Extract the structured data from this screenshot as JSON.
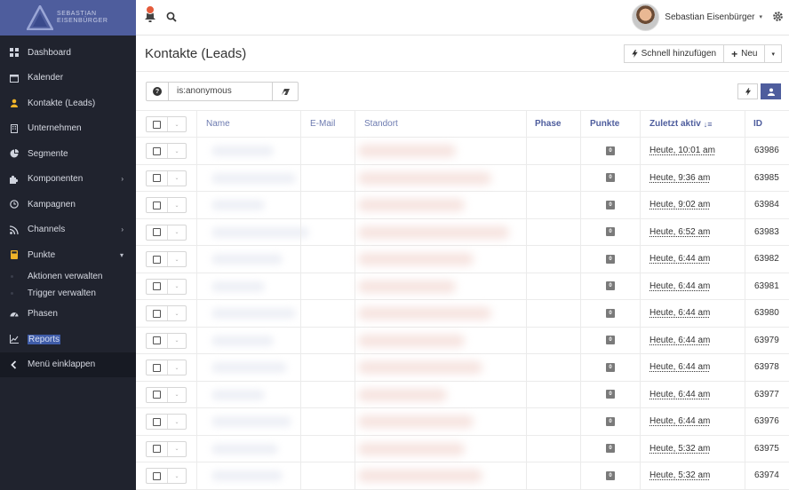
{
  "brand": {
    "line1": "SEBASTIAN",
    "line2": "EISENBÜRGER"
  },
  "sidebar": {
    "items": [
      {
        "label": "Dashboard",
        "icon": "dashboard-icon"
      },
      {
        "label": "Kalender",
        "icon": "calendar-icon"
      },
      {
        "label": "Kontakte (Leads)",
        "icon": "user-icon"
      },
      {
        "label": "Unternehmen",
        "icon": "building-icon"
      },
      {
        "label": "Segmente",
        "icon": "pie-chart-icon"
      },
      {
        "label": "Komponenten",
        "icon": "puzzle-icon",
        "chevron": "›"
      },
      {
        "label": "Kampagnen",
        "icon": "clock-icon"
      },
      {
        "label": "Channels",
        "icon": "rss-icon",
        "chevron": "›"
      },
      {
        "label": "Punkte",
        "icon": "calculator-icon",
        "chevron": "▾"
      }
    ],
    "sub_items": [
      {
        "label": "Aktionen verwalten"
      },
      {
        "label": "Trigger verwalten"
      }
    ],
    "items_after": [
      {
        "label": "Phasen",
        "icon": "tachometer-icon"
      },
      {
        "label": "Reports",
        "icon": "line-chart-icon"
      }
    ],
    "collapse_label": "Menü einklappen"
  },
  "topbar": {
    "user_name": "Sebastian Eisenbürger",
    "user_caret": "▾"
  },
  "header": {
    "title": "Kontakte (Leads)",
    "quick_add_label": "Schnell hinzufügen",
    "new_label": "Neu",
    "new_plus": "+",
    "dropdown_caret": "▾"
  },
  "filter": {
    "value": "is:anonymous",
    "help_glyph": "?"
  },
  "table": {
    "columns": [
      "Name",
      "E-Mail",
      "Standort",
      "Phase",
      "Punkte",
      "Zuletzt aktiv",
      "ID"
    ],
    "sort_glyph": "↓≡",
    "checkbox_caret": "⌄",
    "rows": [
      {
        "points": "0",
        "last_active": "Heute, 10:01 am",
        "id": "63986"
      },
      {
        "points": "0",
        "last_active": "Heute, 9:36 am",
        "id": "63985"
      },
      {
        "points": "0",
        "last_active": "Heute, 9:02 am",
        "id": "63984"
      },
      {
        "points": "0",
        "last_active": "Heute, 6:52 am",
        "id": "63983"
      },
      {
        "points": "0",
        "last_active": "Heute, 6:44 am",
        "id": "63982"
      },
      {
        "points": "0",
        "last_active": "Heute, 6:44 am",
        "id": "63981"
      },
      {
        "points": "0",
        "last_active": "Heute, 6:44 am",
        "id": "63980"
      },
      {
        "points": "0",
        "last_active": "Heute, 6:44 am",
        "id": "63979"
      },
      {
        "points": "0",
        "last_active": "Heute, 6:44 am",
        "id": "63978"
      },
      {
        "points": "0",
        "last_active": "Heute, 6:44 am",
        "id": "63977"
      },
      {
        "points": "0",
        "last_active": "Heute, 6:44 am",
        "id": "63976"
      },
      {
        "points": "0",
        "last_active": "Heute, 5:32 am",
        "id": "63975"
      },
      {
        "points": "0",
        "last_active": "Heute, 5:32 am",
        "id": "63974"
      }
    ]
  },
  "colors": {
    "brand": "#4e5d9d",
    "sidebar": "#20232e",
    "accent_link": "#4e5d9d"
  }
}
